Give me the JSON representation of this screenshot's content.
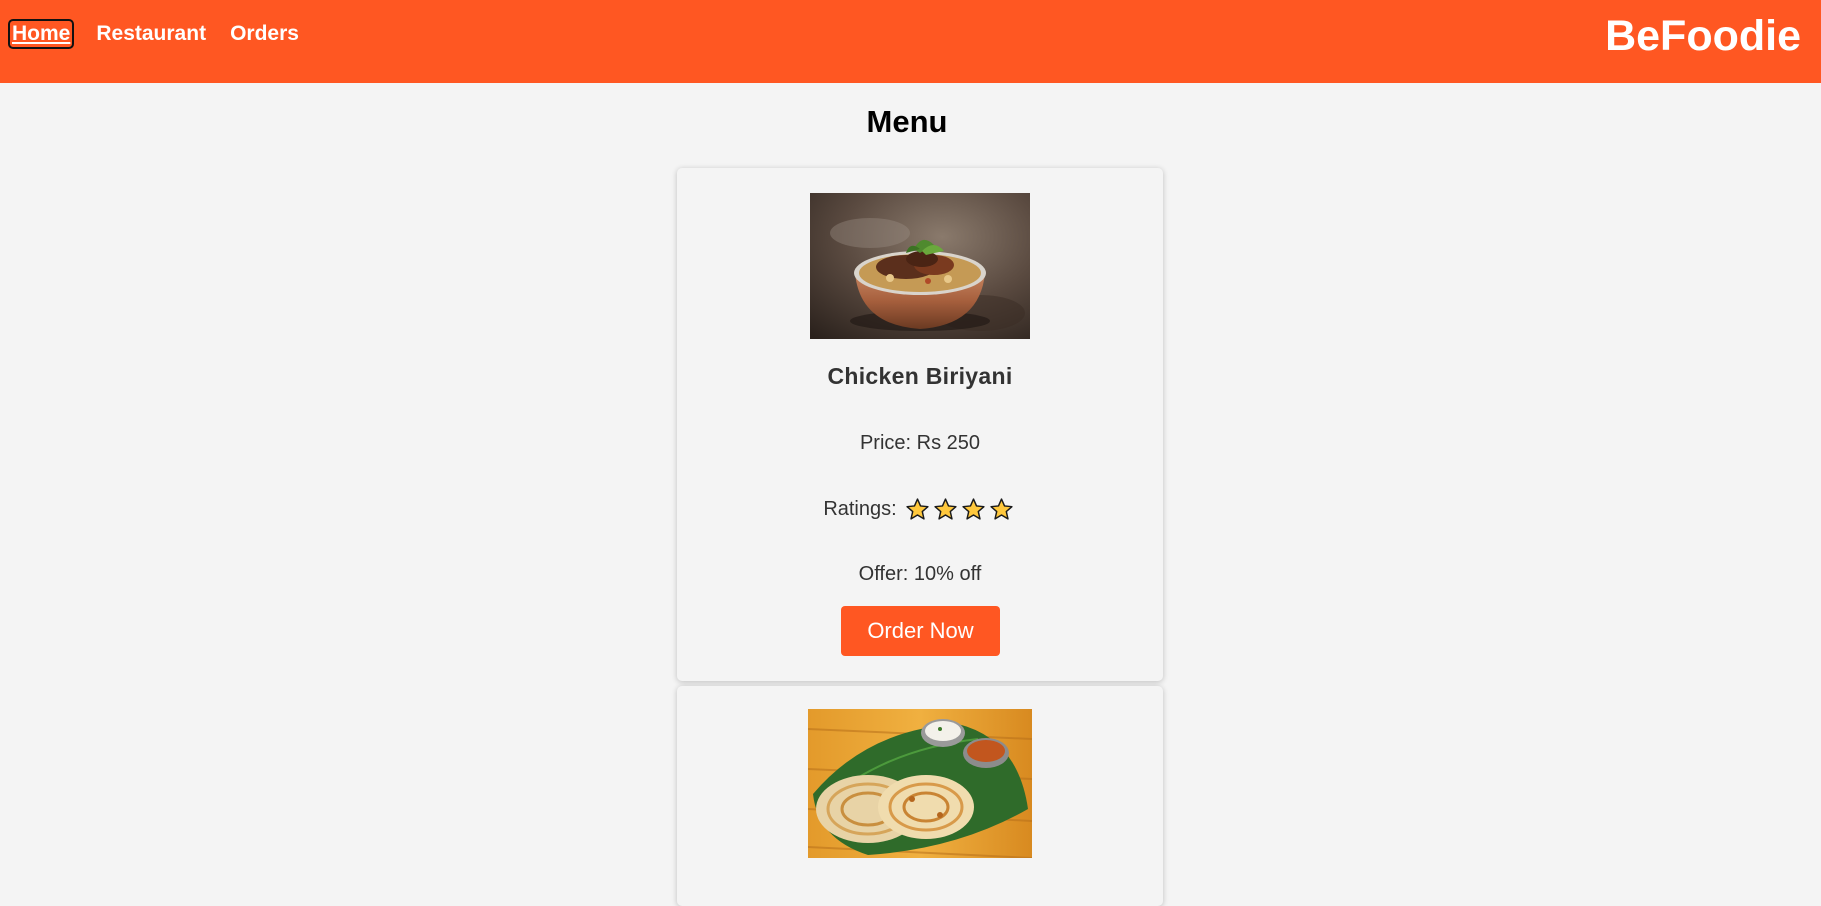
{
  "nav": {
    "links": [
      {
        "label": "Home",
        "active": true
      },
      {
        "label": "Restaurant",
        "active": false
      },
      {
        "label": "Orders",
        "active": false
      }
    ],
    "brand": "BeFoodie"
  },
  "menu": {
    "title": "Menu",
    "items": [
      {
        "name": "Chicken Biriyani",
        "price": "Price: Rs 250",
        "ratings_label": "Ratings:",
        "stars": 4,
        "offer": "Offer: 10% off",
        "order_label": "Order Now",
        "image": "biriyani-bowl-photo"
      },
      {
        "image": "parotta-plate-photo"
      }
    ]
  },
  "colors": {
    "accent": "#ff5722",
    "background": "#f4f4f4",
    "star_fill": "#ffc83d",
    "text": "#333333"
  },
  "icons": {
    "rating": "star-icon"
  }
}
